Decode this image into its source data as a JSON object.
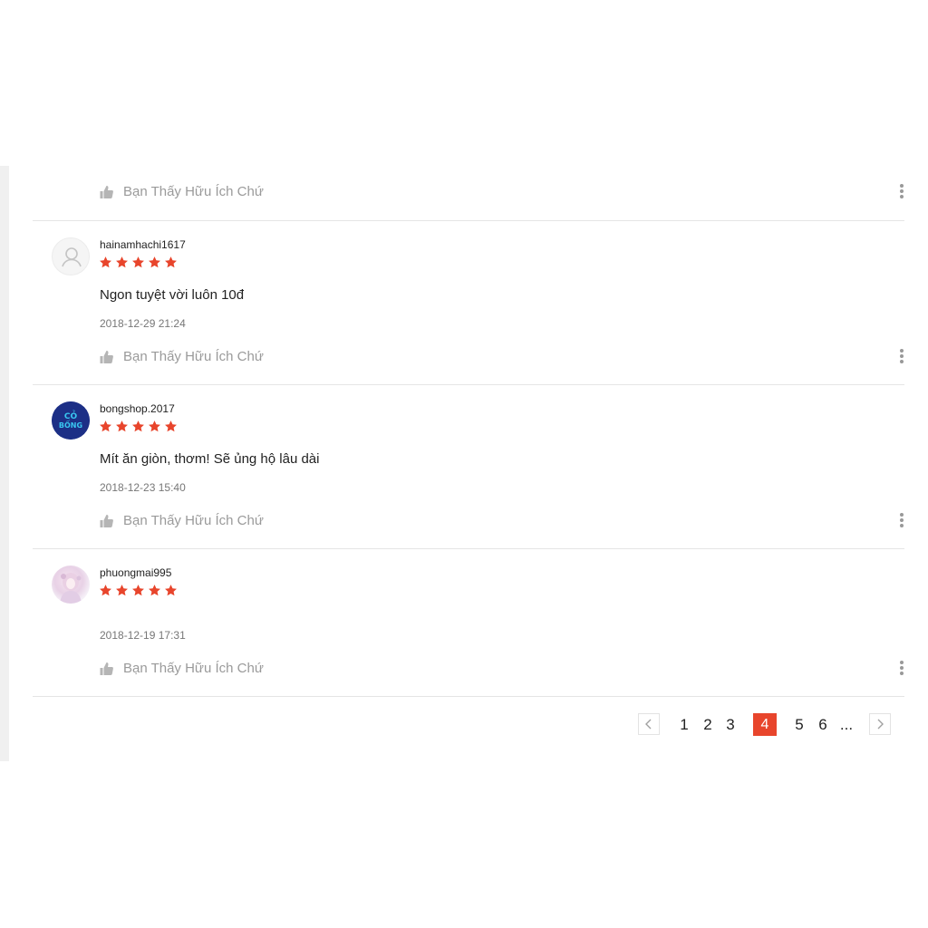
{
  "helpful_label": "Bạn Thấy Hữu Ích Chứ",
  "star_color": "#e8452c",
  "reviews": [
    {
      "username": "hainamhachi1617",
      "rating": 5,
      "comment": "Ngon tuyệt vời luôn 10đ",
      "date": "2018-12-29 21:24",
      "avatar": "default-user-icon"
    },
    {
      "username": "bongshop.2017",
      "rating": 5,
      "comment": "Mít ăn giòn, thơm! Sẽ ủng hộ lâu dài",
      "date": "2018-12-23 15:40",
      "avatar": "shop-logo",
      "avatar_text": [
        "CỎ",
        "BỐNG"
      ]
    },
    {
      "username": "phuongmai995",
      "rating": 5,
      "comment": "",
      "date": "2018-12-19 17:31",
      "avatar": "anime-girl-photo"
    }
  ],
  "pagination": {
    "pages": [
      "1",
      "2",
      "3",
      "4",
      "5",
      "6",
      "..."
    ],
    "current": "4",
    "prev_icon": "chevron-left-icon",
    "next_icon": "chevron-right-icon"
  }
}
